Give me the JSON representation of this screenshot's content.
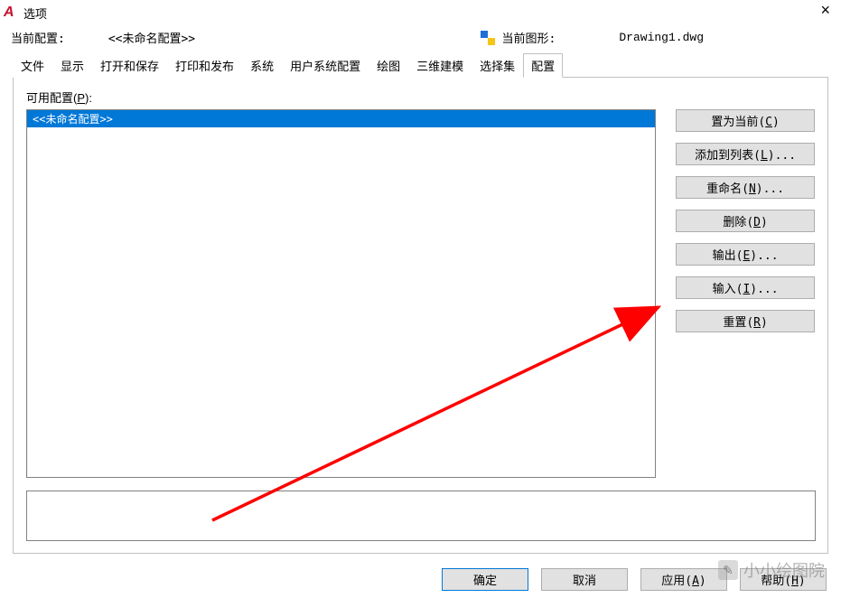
{
  "window": {
    "title": "选项"
  },
  "info": {
    "current_profile_label": "当前配置:",
    "current_profile_value": "<<未命名配置>>",
    "current_drawing_label": "当前图形:",
    "current_drawing_value": "Drawing1.dwg"
  },
  "tabs": {
    "items": [
      {
        "label": "文件"
      },
      {
        "label": "显示"
      },
      {
        "label": "打开和保存"
      },
      {
        "label": "打印和发布"
      },
      {
        "label": "系统"
      },
      {
        "label": "用户系统配置"
      },
      {
        "label": "绘图"
      },
      {
        "label": "三维建模"
      },
      {
        "label": "选择集"
      },
      {
        "label": "配置"
      }
    ],
    "active_index": 9
  },
  "panel": {
    "available_label_prefix": "可用配置(",
    "available_label_hotkey": "P",
    "available_label_suffix": "):",
    "list": {
      "items": [
        {
          "label": "<<未命名配置>>",
          "selected": true
        }
      ]
    },
    "buttons": {
      "set_current": {
        "text": "置为当前(",
        "hotkey": "C",
        "suffix": ")"
      },
      "add_to_list": {
        "text": "添加到列表(",
        "hotkey": "L",
        "suffix": ")..."
      },
      "rename": {
        "text": "重命名(",
        "hotkey": "N",
        "suffix": ")..."
      },
      "delete": {
        "text": "删除(",
        "hotkey": "D",
        "suffix": ")"
      },
      "export": {
        "text": "输出(",
        "hotkey": "E",
        "suffix": ")..."
      },
      "import": {
        "text": "输入(",
        "hotkey": "I",
        "suffix": ")..."
      },
      "reset": {
        "text": "重置(",
        "hotkey": "R",
        "suffix": ")"
      }
    }
  },
  "bottom": {
    "ok": "确定",
    "cancel": "取消",
    "apply": {
      "text": "应用(",
      "hotkey": "A",
      "suffix": ")"
    },
    "help": {
      "text": "帮助(",
      "hotkey": "H",
      "suffix": ")"
    }
  },
  "watermark": "小小绘图院"
}
